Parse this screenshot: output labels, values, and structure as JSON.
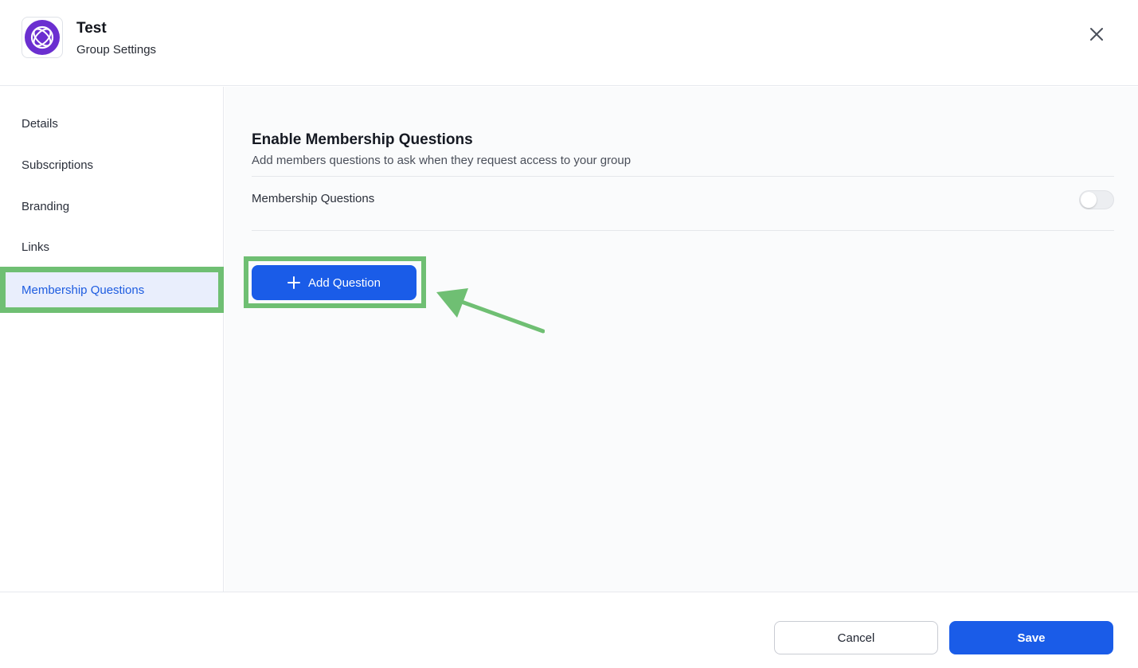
{
  "header": {
    "title": "Test",
    "subtitle": "Group Settings",
    "logo_icon": "group-logo-icon",
    "close_icon": "close-icon"
  },
  "sidebar": {
    "items": [
      {
        "label": "Details",
        "active": false
      },
      {
        "label": "Subscriptions",
        "active": false
      },
      {
        "label": "Branding",
        "active": false
      },
      {
        "label": "Links",
        "active": false
      },
      {
        "label": "Membership Questions",
        "active": true
      }
    ]
  },
  "main": {
    "section_title": "Enable Membership Questions",
    "section_description": "Add members questions to ask when they request access to your group",
    "toggle_label": "Membership Questions",
    "toggle_on": false,
    "add_button_label": "Add Question"
  },
  "footer": {
    "cancel_label": "Cancel",
    "save_label": "Save"
  },
  "colors": {
    "accent": "#1a5ce8",
    "highlight": "#6fbf73",
    "logo": "#6b2fd0"
  }
}
